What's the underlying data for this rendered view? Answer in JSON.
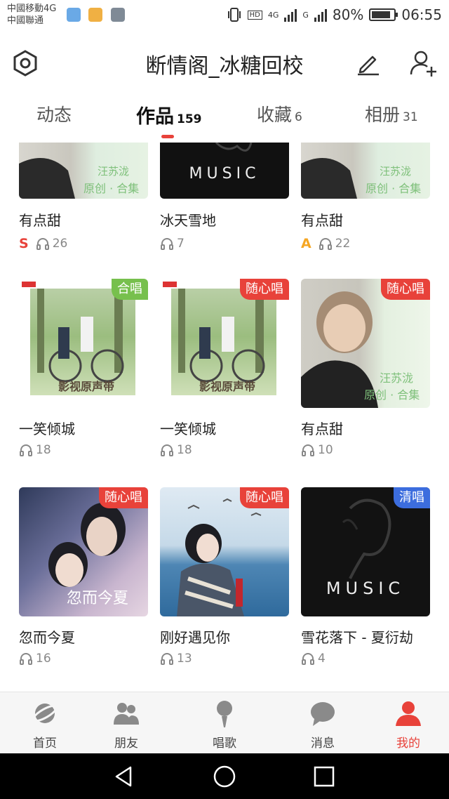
{
  "status_bar": {
    "carrier_1": "中國移動4G",
    "carrier_2": "中國聯通",
    "hd": "HD",
    "net_1": "4G",
    "net_2": "G",
    "battery": "80%",
    "time": "06:55"
  },
  "header": {
    "title": "断情阁_冰糖回校",
    "settings_icon": "hexagon-settings-icon",
    "edit_icon": "pencil-icon",
    "add_friend_icon": "add-user-icon"
  },
  "tabs": [
    {
      "label": "动态",
      "count": ""
    },
    {
      "label": "作品",
      "count": "159"
    },
    {
      "label": "收藏",
      "count": "6"
    },
    {
      "label": "相册",
      "count": "31"
    }
  ],
  "works": [
    {
      "name": "有点甜",
      "plays": "26",
      "level": "S",
      "badge": ""
    },
    {
      "name": "冰天雪地",
      "plays": "7",
      "level": "",
      "badge": ""
    },
    {
      "name": "有点甜",
      "plays": "22",
      "level": "A",
      "badge": ""
    },
    {
      "name": "一笑倾城",
      "plays": "18",
      "level": "",
      "badge": "合唱"
    },
    {
      "name": "一笑倾城",
      "plays": "18",
      "level": "",
      "badge": "随心唱"
    },
    {
      "name": "有点甜",
      "plays": "10",
      "level": "",
      "badge": "随心唱"
    },
    {
      "name": "忽而今夏",
      "plays": "16",
      "level": "",
      "badge": "随心唱"
    },
    {
      "name": "刚好遇见你",
      "plays": "13",
      "level": "",
      "badge": "随心唱"
    },
    {
      "name": "雪花落下 - 夏衍劫",
      "plays": "4",
      "level": "",
      "badge": "清唱"
    }
  ],
  "cover_text": {
    "album": "汪苏泷",
    "album_sub": "原创 · 合集",
    "music": "MUSIC",
    "film": "影视原声带",
    "summer": "忽而今夏"
  },
  "bottom_nav": [
    {
      "label": "首页",
      "icon": "planet-icon"
    },
    {
      "label": "朋友",
      "icon": "friends-icon"
    },
    {
      "label": "唱歌",
      "icon": "microphone-icon"
    },
    {
      "label": "消息",
      "icon": "chat-bubble-icon"
    },
    {
      "label": "我的",
      "icon": "profile-icon"
    }
  ],
  "colors": {
    "accent": "#e8423a",
    "chorus_badge": "#77c04d",
    "acapella_badge": "#3c6dde",
    "level_s": "#e8423a",
    "level_a": "#f5a623"
  }
}
